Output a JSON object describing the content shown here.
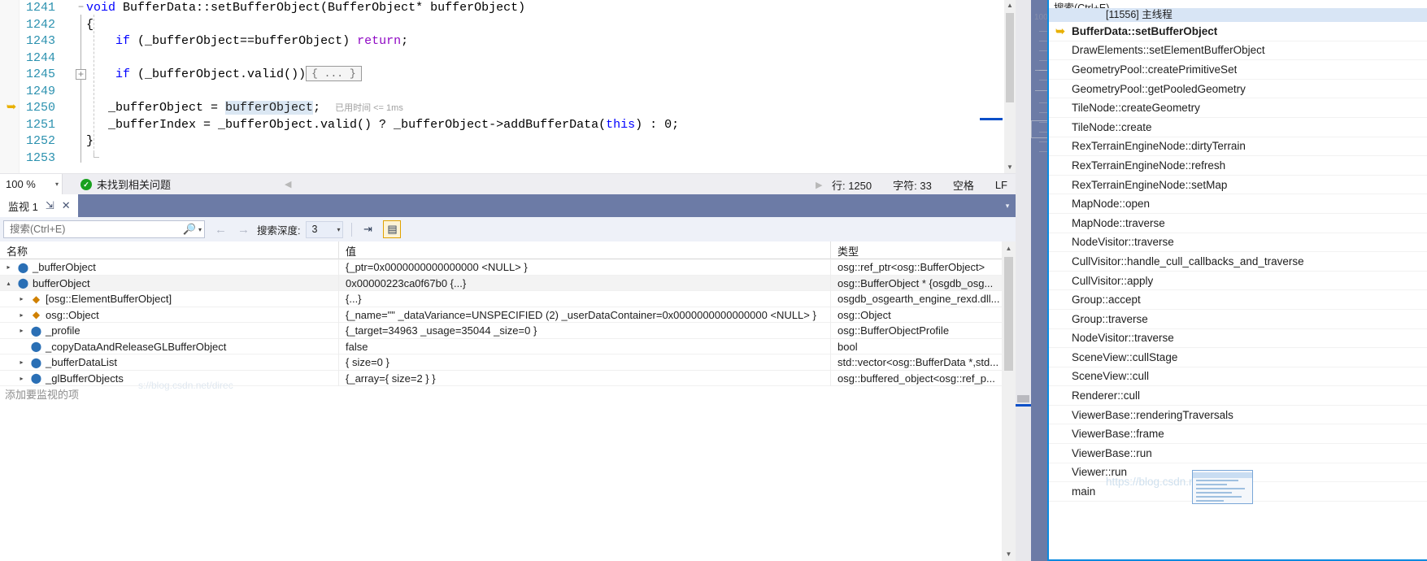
{
  "editor": {
    "lines": [
      {
        "num": "1241",
        "marker": "",
        "fold": "minus",
        "segments": [
          {
            "t": "void ",
            "c": "kw-blue"
          },
          {
            "t": "BufferData::setBufferObject(BufferObject* bufferObject)",
            "c": "plain"
          }
        ]
      },
      {
        "num": "1242",
        "marker": "",
        "fold": "",
        "segments": [
          {
            "t": "{",
            "c": "plain"
          }
        ]
      },
      {
        "num": "1243",
        "marker": "",
        "fold": "",
        "segments": [
          {
            "t": "    ",
            "c": "plain"
          },
          {
            "t": "if",
            "c": "kw-blue"
          },
          {
            "t": " (_bufferObject==bufferObject) ",
            "c": "plain"
          },
          {
            "t": "return",
            "c": "kw-purple"
          },
          {
            "t": ";",
            "c": "plain"
          }
        ]
      },
      {
        "num": "1244",
        "marker": "",
        "fold": "",
        "segments": []
      },
      {
        "num": "1245",
        "marker": "",
        "fold": "plus",
        "segments": [
          {
            "t": "    ",
            "c": "plain"
          },
          {
            "t": "if",
            "c": "kw-blue"
          },
          {
            "t": " (_bufferObject.valid())",
            "c": "plain"
          },
          {
            "t": "{ ... }",
            "c": "collapsed"
          }
        ]
      },
      {
        "num": "1249",
        "marker": "",
        "fold": "",
        "segments": []
      },
      {
        "num": "1250",
        "marker": "arrow",
        "fold": "",
        "segments": [
          {
            "t": "   _bufferObject = ",
            "c": "plain"
          },
          {
            "t": "bufferObject",
            "c": "hl-word"
          },
          {
            "t": ";  ",
            "c": "plain"
          },
          {
            "t": "已用时间 <= 1ms",
            "c": "elapsed"
          }
        ]
      },
      {
        "num": "1251",
        "marker": "",
        "fold": "",
        "segments": [
          {
            "t": "   _bufferIndex = _bufferObject.valid() ? _bufferObject->addBufferData(",
            "c": "plain"
          },
          {
            "t": "this",
            "c": "kw-blue"
          },
          {
            "t": ") : 0;",
            "c": "plain"
          }
        ]
      },
      {
        "num": "1252",
        "marker": "",
        "fold": "",
        "segments": [
          {
            "t": "}",
            "c": "plain"
          }
        ]
      },
      {
        "num": "1253",
        "marker": "",
        "fold": "",
        "segments": []
      }
    ]
  },
  "editor_status": {
    "zoom": "100 %",
    "zoom_arrow": "▾",
    "message": "未找到相关问题",
    "ok_glyph": "✓",
    "nav_prev": "◀",
    "nav_next": "▶",
    "line_info": "行: 1250",
    "char_info": "字符: 33",
    "indent_info": "空格",
    "eol_info": "LF"
  },
  "watch": {
    "tab_label": "监视 1",
    "pin_glyph": "⇲",
    "close_glyph": "✕",
    "tabstrip_overflow": "▾",
    "search": {
      "placeholder": "搜索(Ctrl+E)",
      "value": "",
      "icon": "search-icon",
      "dropdown_glyph": "▾"
    },
    "nav_back": "←",
    "nav_forward": "→",
    "depth_label": "搜索深度:",
    "depth_value": "3",
    "depth_arrow": "▾",
    "pin_tool_glyph": "⇥",
    "hex_tool_glyph": "▤",
    "columns": [
      "名称",
      "值",
      "类型"
    ],
    "rows": [
      {
        "expander": "▸",
        "indent": 0,
        "icon": "field",
        "name": "_bufferObject",
        "value": "{_ptr=0x0000000000000000 <NULL> }",
        "type": "osg::ref_ptr<osg::BufferObject>",
        "alt": false
      },
      {
        "expander": "▴",
        "indent": 0,
        "icon": "field",
        "name": "bufferObject",
        "value": "0x00000223ca0f67b0 {...}",
        "type": "osg::BufferObject * {osgdb_osg...",
        "alt": true
      },
      {
        "expander": "▸",
        "indent": 1,
        "icon": "cls",
        "name": "[osg::ElementBufferObject]",
        "value": "{...}",
        "type": "osgdb_osgearth_engine_rexd.dll...",
        "alt": false
      },
      {
        "expander": "▸",
        "indent": 1,
        "icon": "cls",
        "name": "osg::Object",
        "value": "{_name=\"\" _dataVariance=UNSPECIFIED (2) _userDataContainer=0x0000000000000000 <NULL> }",
        "type": "osg::Object",
        "alt": false
      },
      {
        "expander": "▸",
        "indent": 1,
        "icon": "field",
        "name": "_profile",
        "value": "{_target=34963 _usage=35044 _size=0 }",
        "type": "osg::BufferObjectProfile",
        "alt": false
      },
      {
        "expander": "",
        "indent": 1,
        "icon": "field",
        "name": "_copyDataAndReleaseGLBufferObject",
        "value": "false",
        "type": "bool",
        "alt": false
      },
      {
        "expander": "▸",
        "indent": 1,
        "icon": "field",
        "name": "_bufferDataList",
        "value": "{ size=0 }",
        "type": "std::vector<osg::BufferData *,std...",
        "alt": false
      },
      {
        "expander": "▸",
        "indent": 1,
        "icon": "field",
        "name": "_glBufferObjects",
        "value": "{_array={ size=2 } }",
        "type": "osg::buffered_object<osg::ref_p...",
        "alt": false
      }
    ],
    "add_item_text": "添加要监视的项",
    "scroll_up": "▲",
    "scroll_down": "▼"
  },
  "callstack": {
    "search_placeholder": "搜索(Ctrl+E)",
    "thread_header": "[11556] 主线程",
    "current_marker": "⇨",
    "frames": [
      {
        "label": "BufferData::setBufferObject",
        "current": true
      },
      {
        "label": "DrawElements::setElementBufferObject",
        "current": false
      },
      {
        "label": "GeometryPool::createPrimitiveSet",
        "current": false
      },
      {
        "label": "GeometryPool::getPooledGeometry",
        "current": false
      },
      {
        "label": "TileNode::createGeometry",
        "current": false
      },
      {
        "label": "TileNode::create",
        "current": false
      },
      {
        "label": "RexTerrainEngineNode::dirtyTerrain",
        "current": false
      },
      {
        "label": "RexTerrainEngineNode::refresh",
        "current": false
      },
      {
        "label": "RexTerrainEngineNode::setMap",
        "current": false
      },
      {
        "label": "MapNode::open",
        "current": false
      },
      {
        "label": "MapNode::traverse",
        "current": false
      },
      {
        "label": "NodeVisitor::traverse",
        "current": false
      },
      {
        "label": "CullVisitor::handle_cull_callbacks_and_traverse",
        "current": false
      },
      {
        "label": "CullVisitor::apply",
        "current": false
      },
      {
        "label": "Group::accept",
        "current": false
      },
      {
        "label": "Group::traverse",
        "current": false
      },
      {
        "label": "NodeVisitor::traverse",
        "current": false
      },
      {
        "label": "SceneView::cullStage",
        "current": false
      },
      {
        "label": "SceneView::cull",
        "current": false
      },
      {
        "label": "Renderer::cull",
        "current": false
      },
      {
        "label": "ViewerBase::renderingTraversals",
        "current": false
      },
      {
        "label": "ViewerBase::frame",
        "current": false
      },
      {
        "label": "ViewerBase::run",
        "current": false
      },
      {
        "label": "Viewer::run",
        "current": false
      },
      {
        "label": "main",
        "current": false
      }
    ]
  },
  "watermark": {
    "text": "https://blog.csdn.net/direc",
    "text2": "s://blog.csdn.net/direc"
  },
  "colors": {
    "accent_blue": "#0a8ae0",
    "panel_blue": "#6c7ba6",
    "keyword": "#0000ff",
    "line_number": "#2b91af",
    "highlight": "#dbe7f3",
    "ok_green": "#19a01e",
    "arrow_yellow": "#e8b000"
  }
}
